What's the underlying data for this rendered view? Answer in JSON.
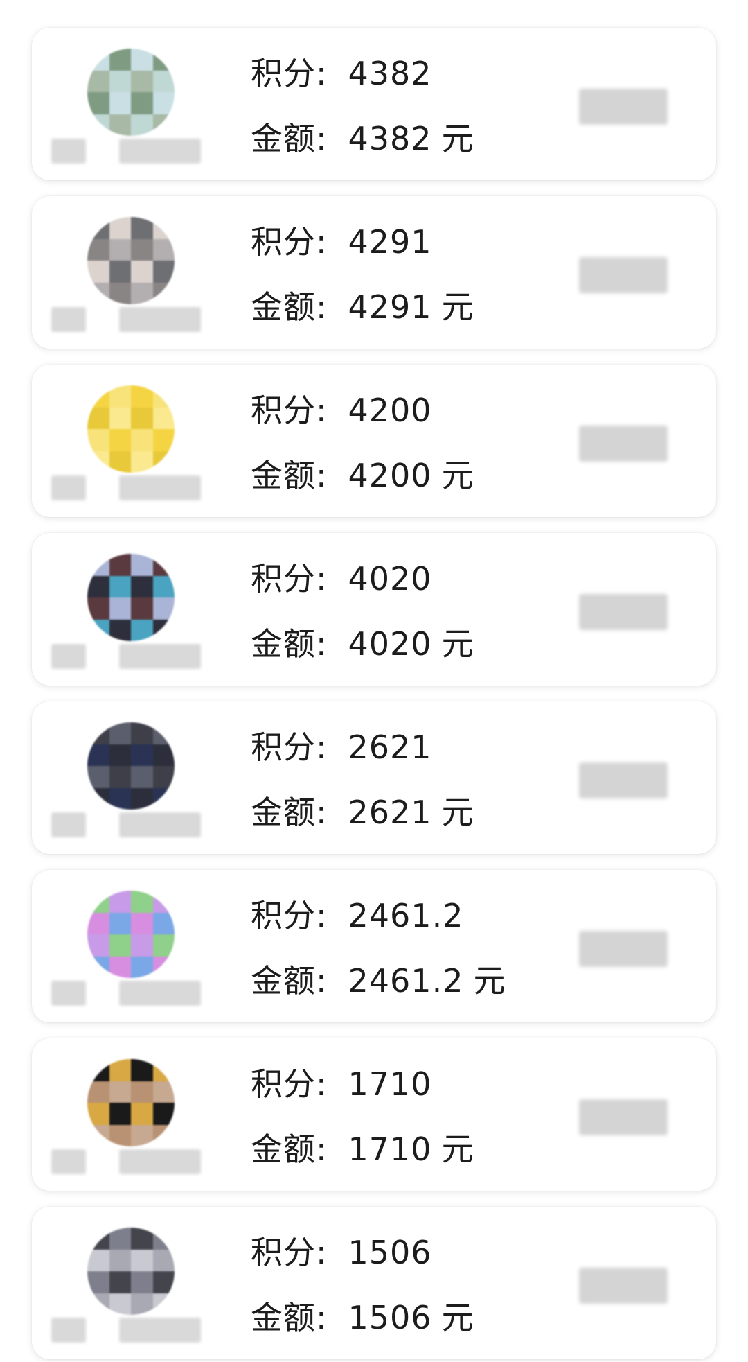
{
  "labels": {
    "score": "积分:",
    "amount": "金额:",
    "unit": "元"
  },
  "records": [
    {
      "score": "4382",
      "amount": "4382",
      "avatar_colors": [
        "#c9dfe3",
        "#bfd8d4",
        "#7f9c83",
        "#a8b9a6"
      ]
    },
    {
      "score": "4291",
      "amount": "4291",
      "avatar_colors": [
        "#8a8585",
        "#6e6f73",
        "#b3aeb0",
        "#dcd3cf"
      ]
    },
    {
      "score": "4200",
      "amount": "4200",
      "avatar_colors": [
        "#f7e37a",
        "#e8c93a",
        "#f5d443",
        "#fbe98f"
      ]
    },
    {
      "score": "4020",
      "amount": "4020",
      "avatar_colors": [
        "#4aa3c0",
        "#5a3a3e",
        "#2e2f3d",
        "#a9b4d6"
      ]
    },
    {
      "score": "2621",
      "amount": "2621",
      "avatar_colors": [
        "#3e3f48",
        "#2c2f3b",
        "#5b5e6c",
        "#2a3354"
      ]
    },
    {
      "score": "2461.2",
      "amount": "2461.2",
      "avatar_colors": [
        "#d88ee0",
        "#8fd08a",
        "#7aa7e6",
        "#c79be8"
      ]
    },
    {
      "score": "1710",
      "amount": "1710",
      "avatar_colors": [
        "#d7a843",
        "#b89272",
        "#1a1a1a",
        "#c7a890"
      ]
    },
    {
      "score": "1506",
      "amount": "1506",
      "avatar_colors": [
        "#a9a9b4",
        "#7e7f8c",
        "#c9c9d1",
        "#44444c"
      ]
    }
  ]
}
